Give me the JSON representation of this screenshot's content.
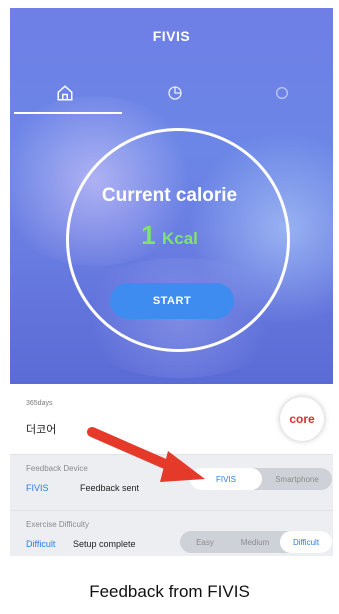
{
  "app": {
    "title": "FIVIS",
    "tabs": [
      {
        "name": "home",
        "icon": "home-icon"
      },
      {
        "name": "stats",
        "icon": "pie-chart-icon"
      },
      {
        "name": "extra",
        "icon": "circle-icon"
      }
    ]
  },
  "hero": {
    "title": "Current calorie",
    "value": "1",
    "unit": "Kcal",
    "start_label": "START"
  },
  "profile": {
    "days": "365days",
    "name": "더코어",
    "badge": "core"
  },
  "feedback_device": {
    "label": "Feedback Device",
    "selected": "FIVIS",
    "status": "Feedback sent",
    "options": [
      "FIVIS",
      "Smartphone"
    ]
  },
  "exercise_difficulty": {
    "label": "Exercise Difficulty",
    "selected": "Difficult",
    "status": "Setup complete",
    "options": [
      "Easy",
      "Medium",
      "Difficult"
    ]
  },
  "caption": "Feedback from FIVIS",
  "colors": {
    "accent": "#3f8cf0",
    "calorie": "#7ee36f",
    "arrow": "#e53a2a"
  }
}
